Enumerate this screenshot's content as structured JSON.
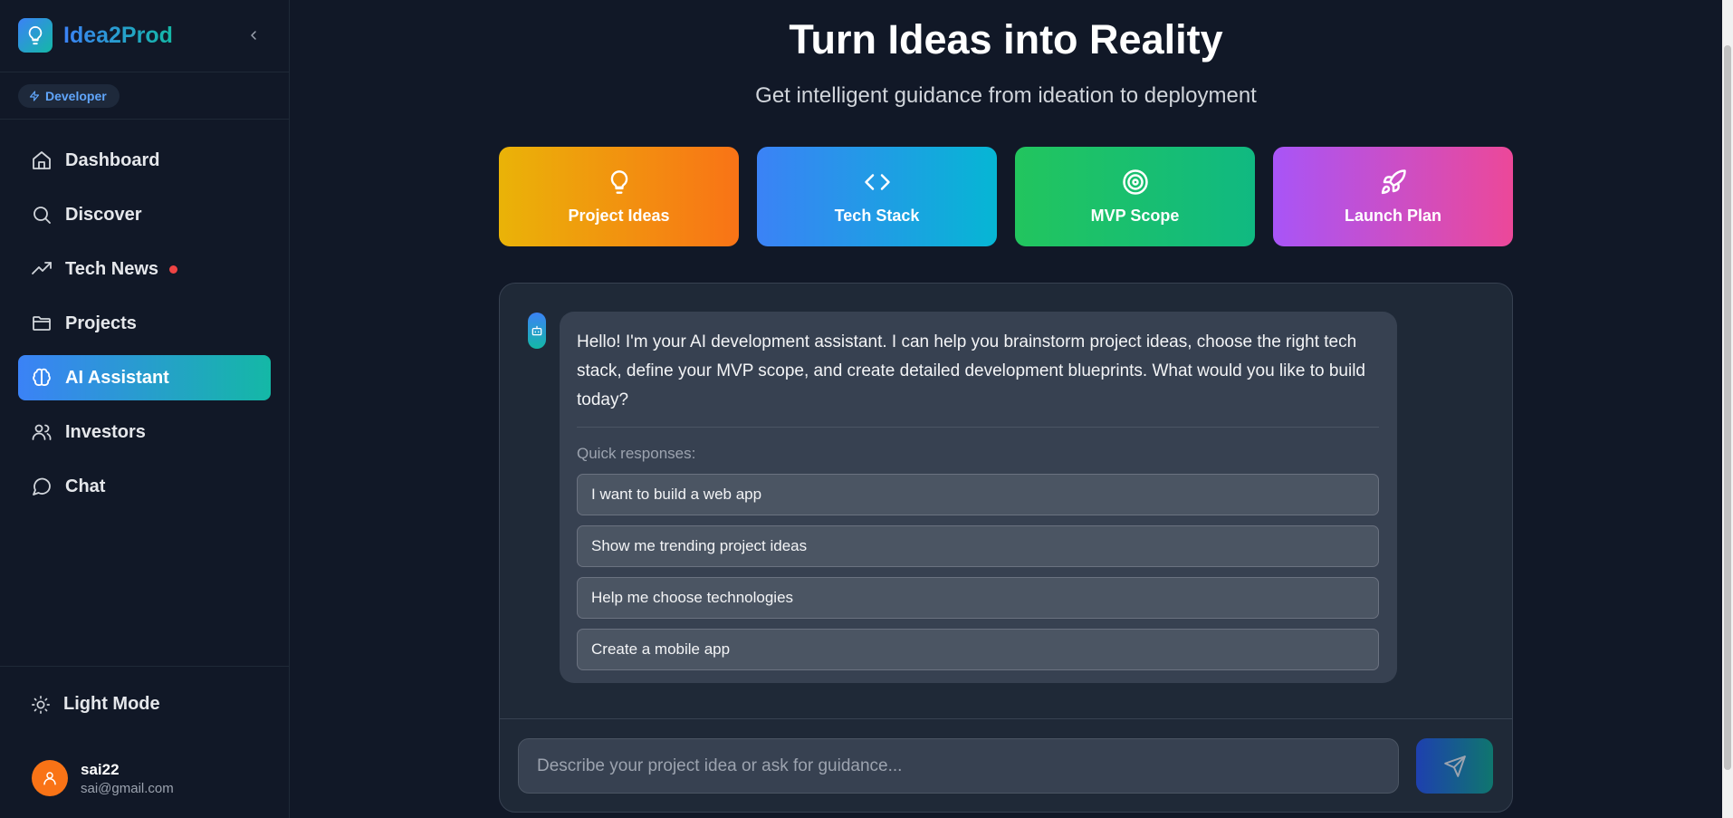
{
  "sidebar": {
    "brand": "Idea2Prod",
    "role_badge": "Developer",
    "nav": [
      {
        "label": "Dashboard",
        "icon": "home-icon"
      },
      {
        "label": "Discover",
        "icon": "search-icon"
      },
      {
        "label": "Tech News",
        "icon": "trending-up-icon",
        "notification": true
      },
      {
        "label": "Projects",
        "icon": "folder-icon"
      },
      {
        "label": "AI Assistant",
        "icon": "brain-icon",
        "active": true
      },
      {
        "label": "Investors",
        "icon": "users-icon"
      },
      {
        "label": "Chat",
        "icon": "message-circle-icon"
      }
    ],
    "theme_toggle": "Light Mode",
    "user": {
      "name": "sai22",
      "email": "sai@gmail.com"
    }
  },
  "main": {
    "title": "Turn Ideas into Reality",
    "subtitle": "Get intelligent guidance from ideation to deployment",
    "cards": [
      {
        "label": "Project Ideas",
        "icon": "lightbulb-icon"
      },
      {
        "label": "Tech Stack",
        "icon": "code-icon"
      },
      {
        "label": "MVP Scope",
        "icon": "target-icon"
      },
      {
        "label": "Launch Plan",
        "icon": "rocket-icon"
      }
    ],
    "chat": {
      "message": "Hello! I'm your AI development assistant. I can help you brainstorm project ideas, choose the right tech stack, define your MVP scope, and create detailed development blueprints. What would you like to build today?",
      "quick_label": "Quick responses:",
      "quick_responses": [
        "I want to build a web app",
        "Show me trending project ideas",
        "Help me choose technologies",
        "Create a mobile app"
      ],
      "input_placeholder": "Describe your project idea or ask for guidance..."
    }
  },
  "colors": {
    "background": "#111827",
    "accent_blue": "#3b82f6",
    "accent_teal": "#14b8a6",
    "notification": "#ef4444"
  }
}
